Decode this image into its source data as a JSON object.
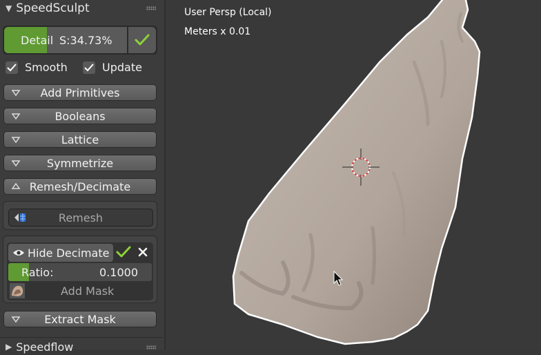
{
  "panel": {
    "header_title": "SpeedSculpt",
    "detail": {
      "label": "Detail",
      "value_text": "S:34.73%",
      "level_percent": 34.73
    },
    "smooth_label": "Smooth",
    "update_label": "Update",
    "smooth_checked": true,
    "update_checked": true,
    "sections": {
      "add_primitives": "Add Primitives",
      "booleans": "Booleans",
      "lattice": "Lattice",
      "symmetrize": "Symmetrize",
      "remesh_decimate": "Remesh/Decimate",
      "extract_mask": "Extract Mask"
    },
    "remesh_label": "Remesh",
    "decimate": {
      "hide_label": "Hide Decimate",
      "ratio_label": "Ratio:",
      "ratio_value": "0.1000",
      "add_mask_label": "Add Mask"
    },
    "next_header_title": "Speedflow"
  },
  "viewport": {
    "view_name": "User Persp (Local)",
    "units": "Meters x 0.01"
  },
  "colors": {
    "accent_green": "#5f9a33",
    "check_green": "#8fd13a",
    "panel_bg": "#3c3c3c",
    "viewport_bg": "#393939",
    "mesh": "#b3a89f"
  }
}
